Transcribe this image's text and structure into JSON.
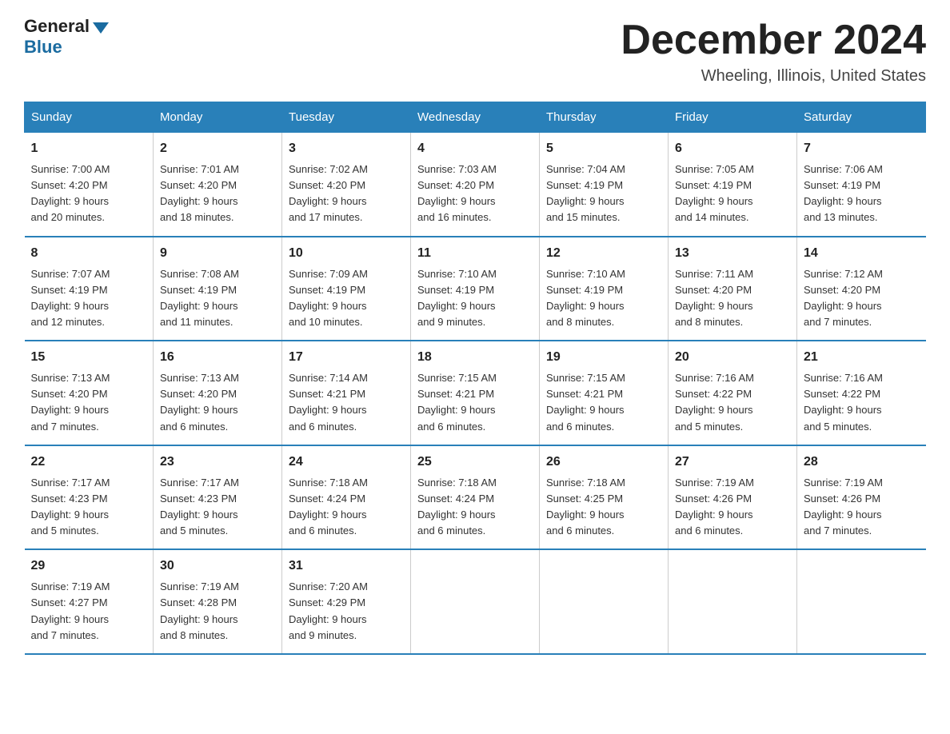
{
  "header": {
    "logo_text1": "General",
    "logo_text2": "Blue",
    "month_title": "December 2024",
    "location": "Wheeling, Illinois, United States"
  },
  "weekdays": [
    "Sunday",
    "Monday",
    "Tuesday",
    "Wednesday",
    "Thursday",
    "Friday",
    "Saturday"
  ],
  "weeks": [
    [
      {
        "day": "1",
        "sunrise": "7:00 AM",
        "sunset": "4:20 PM",
        "daylight": "9 hours and 20 minutes."
      },
      {
        "day": "2",
        "sunrise": "7:01 AM",
        "sunset": "4:20 PM",
        "daylight": "9 hours and 18 minutes."
      },
      {
        "day": "3",
        "sunrise": "7:02 AM",
        "sunset": "4:20 PM",
        "daylight": "9 hours and 17 minutes."
      },
      {
        "day": "4",
        "sunrise": "7:03 AM",
        "sunset": "4:20 PM",
        "daylight": "9 hours and 16 minutes."
      },
      {
        "day": "5",
        "sunrise": "7:04 AM",
        "sunset": "4:19 PM",
        "daylight": "9 hours and 15 minutes."
      },
      {
        "day": "6",
        "sunrise": "7:05 AM",
        "sunset": "4:19 PM",
        "daylight": "9 hours and 14 minutes."
      },
      {
        "day": "7",
        "sunrise": "7:06 AM",
        "sunset": "4:19 PM",
        "daylight": "9 hours and 13 minutes."
      }
    ],
    [
      {
        "day": "8",
        "sunrise": "7:07 AM",
        "sunset": "4:19 PM",
        "daylight": "9 hours and 12 minutes."
      },
      {
        "day": "9",
        "sunrise": "7:08 AM",
        "sunset": "4:19 PM",
        "daylight": "9 hours and 11 minutes."
      },
      {
        "day": "10",
        "sunrise": "7:09 AM",
        "sunset": "4:19 PM",
        "daylight": "9 hours and 10 minutes."
      },
      {
        "day": "11",
        "sunrise": "7:10 AM",
        "sunset": "4:19 PM",
        "daylight": "9 hours and 9 minutes."
      },
      {
        "day": "12",
        "sunrise": "7:10 AM",
        "sunset": "4:19 PM",
        "daylight": "9 hours and 8 minutes."
      },
      {
        "day": "13",
        "sunrise": "7:11 AM",
        "sunset": "4:20 PM",
        "daylight": "9 hours and 8 minutes."
      },
      {
        "day": "14",
        "sunrise": "7:12 AM",
        "sunset": "4:20 PM",
        "daylight": "9 hours and 7 minutes."
      }
    ],
    [
      {
        "day": "15",
        "sunrise": "7:13 AM",
        "sunset": "4:20 PM",
        "daylight": "9 hours and 7 minutes."
      },
      {
        "day": "16",
        "sunrise": "7:13 AM",
        "sunset": "4:20 PM",
        "daylight": "9 hours and 6 minutes."
      },
      {
        "day": "17",
        "sunrise": "7:14 AM",
        "sunset": "4:21 PM",
        "daylight": "9 hours and 6 minutes."
      },
      {
        "day": "18",
        "sunrise": "7:15 AM",
        "sunset": "4:21 PM",
        "daylight": "9 hours and 6 minutes."
      },
      {
        "day": "19",
        "sunrise": "7:15 AM",
        "sunset": "4:21 PM",
        "daylight": "9 hours and 6 minutes."
      },
      {
        "day": "20",
        "sunrise": "7:16 AM",
        "sunset": "4:22 PM",
        "daylight": "9 hours and 5 minutes."
      },
      {
        "day": "21",
        "sunrise": "7:16 AM",
        "sunset": "4:22 PM",
        "daylight": "9 hours and 5 minutes."
      }
    ],
    [
      {
        "day": "22",
        "sunrise": "7:17 AM",
        "sunset": "4:23 PM",
        "daylight": "9 hours and 5 minutes."
      },
      {
        "day": "23",
        "sunrise": "7:17 AM",
        "sunset": "4:23 PM",
        "daylight": "9 hours and 5 minutes."
      },
      {
        "day": "24",
        "sunrise": "7:18 AM",
        "sunset": "4:24 PM",
        "daylight": "9 hours and 6 minutes."
      },
      {
        "day": "25",
        "sunrise": "7:18 AM",
        "sunset": "4:24 PM",
        "daylight": "9 hours and 6 minutes."
      },
      {
        "day": "26",
        "sunrise": "7:18 AM",
        "sunset": "4:25 PM",
        "daylight": "9 hours and 6 minutes."
      },
      {
        "day": "27",
        "sunrise": "7:19 AM",
        "sunset": "4:26 PM",
        "daylight": "9 hours and 6 minutes."
      },
      {
        "day": "28",
        "sunrise": "7:19 AM",
        "sunset": "4:26 PM",
        "daylight": "9 hours and 7 minutes."
      }
    ],
    [
      {
        "day": "29",
        "sunrise": "7:19 AM",
        "sunset": "4:27 PM",
        "daylight": "9 hours and 7 minutes."
      },
      {
        "day": "30",
        "sunrise": "7:19 AM",
        "sunset": "4:28 PM",
        "daylight": "9 hours and 8 minutes."
      },
      {
        "day": "31",
        "sunrise": "7:20 AM",
        "sunset": "4:29 PM",
        "daylight": "9 hours and 9 minutes."
      },
      null,
      null,
      null,
      null
    ]
  ]
}
